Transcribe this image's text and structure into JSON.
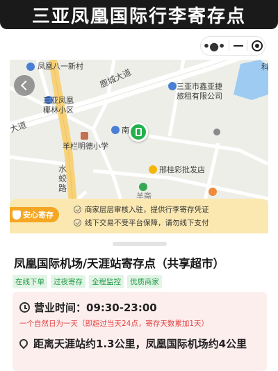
{
  "banner": {
    "title": "三亚凤凰国际行李寄存点"
  },
  "map": {
    "labels": {
      "phoenix81": "凤凰八一新村",
      "lucheng_road": "鹿城大道",
      "sanya_company_line1": "三亚市鑫亚捷",
      "sanya_company_line2": "旅租有限公司",
      "phoenix_estate_line1": "三亚凤凰",
      "phoenix_estate_line2": "椰林小区",
      "road_left": "大道",
      "nan": "南",
      "school": "羊栏明德小学",
      "lottery": "邢桂彩批发店",
      "shuijiao_road": "水蛟路",
      "ke": "科",
      "bottom_partial": "羊斋"
    },
    "pin_icon": "luggage-icon",
    "back_icon": "chevron-left-icon"
  },
  "notice": {
    "badge": "安心寄存",
    "lines": [
      "商家层层审核入驻，提供行李寄存凭证",
      "线下交易不受平台保障，请勿线下支付"
    ]
  },
  "store": {
    "name": "凤凰国际机场/天涯站寄存点（共享超市）",
    "tags": [
      "在线下单",
      "过夜寄存",
      "全程监控",
      "优质商家"
    ],
    "hours": "营业时间：09:30-23:00",
    "hours_note": "一个自然日为一天（即超过当天24点，寄存天数累加1天）",
    "location": "距离天涯站约1.3公里，凤凰国际机场约4公里"
  },
  "colors": {
    "accent_green": "#22b14c",
    "notice_bg": "#fbe8b1",
    "badge": "#f5a623",
    "warning_red": "#e04040"
  }
}
